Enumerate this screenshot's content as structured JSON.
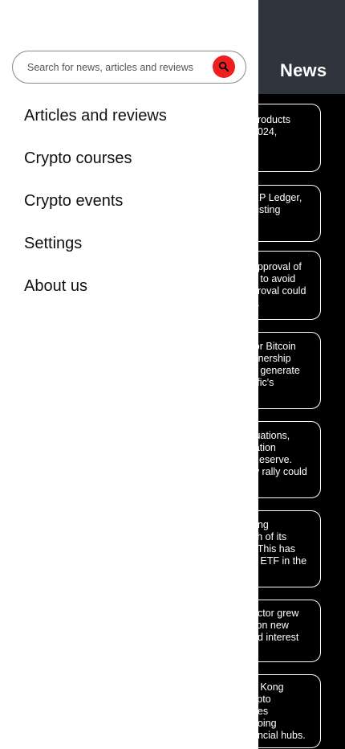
{
  "header": {
    "title": "News",
    "background": "#30343d"
  },
  "news": [
    {
      "text": "products\n2024,\nr"
    },
    {
      "text": "RP Ledger,\nxisting"
    },
    {
      "text": "approval of\ne to avoid\nproval could\ns."
    },
    {
      "text": "jor Bitcoin\nrtnership\no generate\ntific's"
    },
    {
      "text": "tuations,\nlation\nReserve.\nw rally could"
    },
    {
      "text": "ong\nch of its\n. This has\nd ETF in the"
    },
    {
      "text": "ector grew\nlion new\nnd interest"
    },
    {
      "text": "g Kong\nypto\nges\ngoing\nancial hubs."
    }
  ],
  "drawer": {
    "search": {
      "placeholder": "Search for news, articles and reviews",
      "button_color": "#f01e1e"
    },
    "menu": [
      {
        "label": "Articles and reviews"
      },
      {
        "label": "Crypto courses"
      },
      {
        "label": "Crypto events"
      },
      {
        "label": "Settings"
      },
      {
        "label": "About us"
      }
    ]
  }
}
